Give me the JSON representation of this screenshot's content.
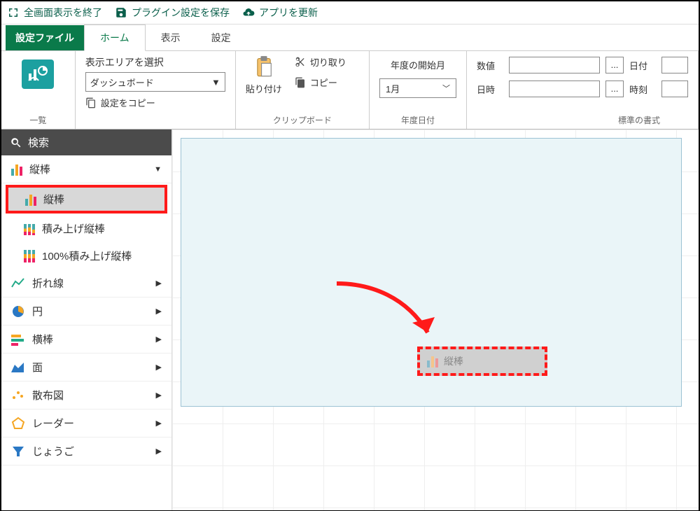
{
  "toolbar": {
    "exit_fullscreen": "全画面表示を終了",
    "save_plugin": "プラグイン設定を保存",
    "update_app": "アプリを更新"
  },
  "tabs": {
    "file": "設定ファイル",
    "home": "ホーム",
    "view": "表示",
    "settings": "設定"
  },
  "ribbon": {
    "list_label": "一覧",
    "area": {
      "title": "表示エリアを選択",
      "combo_value": "ダッシュボード",
      "copy_settings": "設定をコピー"
    },
    "clipboard": {
      "paste": "貼り付け",
      "cut": "切り取り",
      "copy": "コピー",
      "group_label": "クリップボード"
    },
    "fiscal": {
      "title": "年度の開始月",
      "combo_value": "1月",
      "group_label": "年度日付"
    },
    "format": {
      "numeric": "数値",
      "datetime": "日時",
      "date": "日付",
      "time": "時刻",
      "dots": "...",
      "group_label": "標準の書式"
    }
  },
  "sidebar": {
    "search": "検索",
    "categories": {
      "column": "縦棒",
      "column_sub1": "縦棒",
      "column_sub2": "積み上げ縦棒",
      "column_sub3": "100%積み上げ縦棒",
      "line": "折れ線",
      "pie": "円",
      "bar": "横棒",
      "area": "面",
      "scatter": "散布図",
      "radar": "レーダー",
      "funnel": "じょうご"
    }
  },
  "canvas": {
    "ghost_label": "縦棒"
  }
}
